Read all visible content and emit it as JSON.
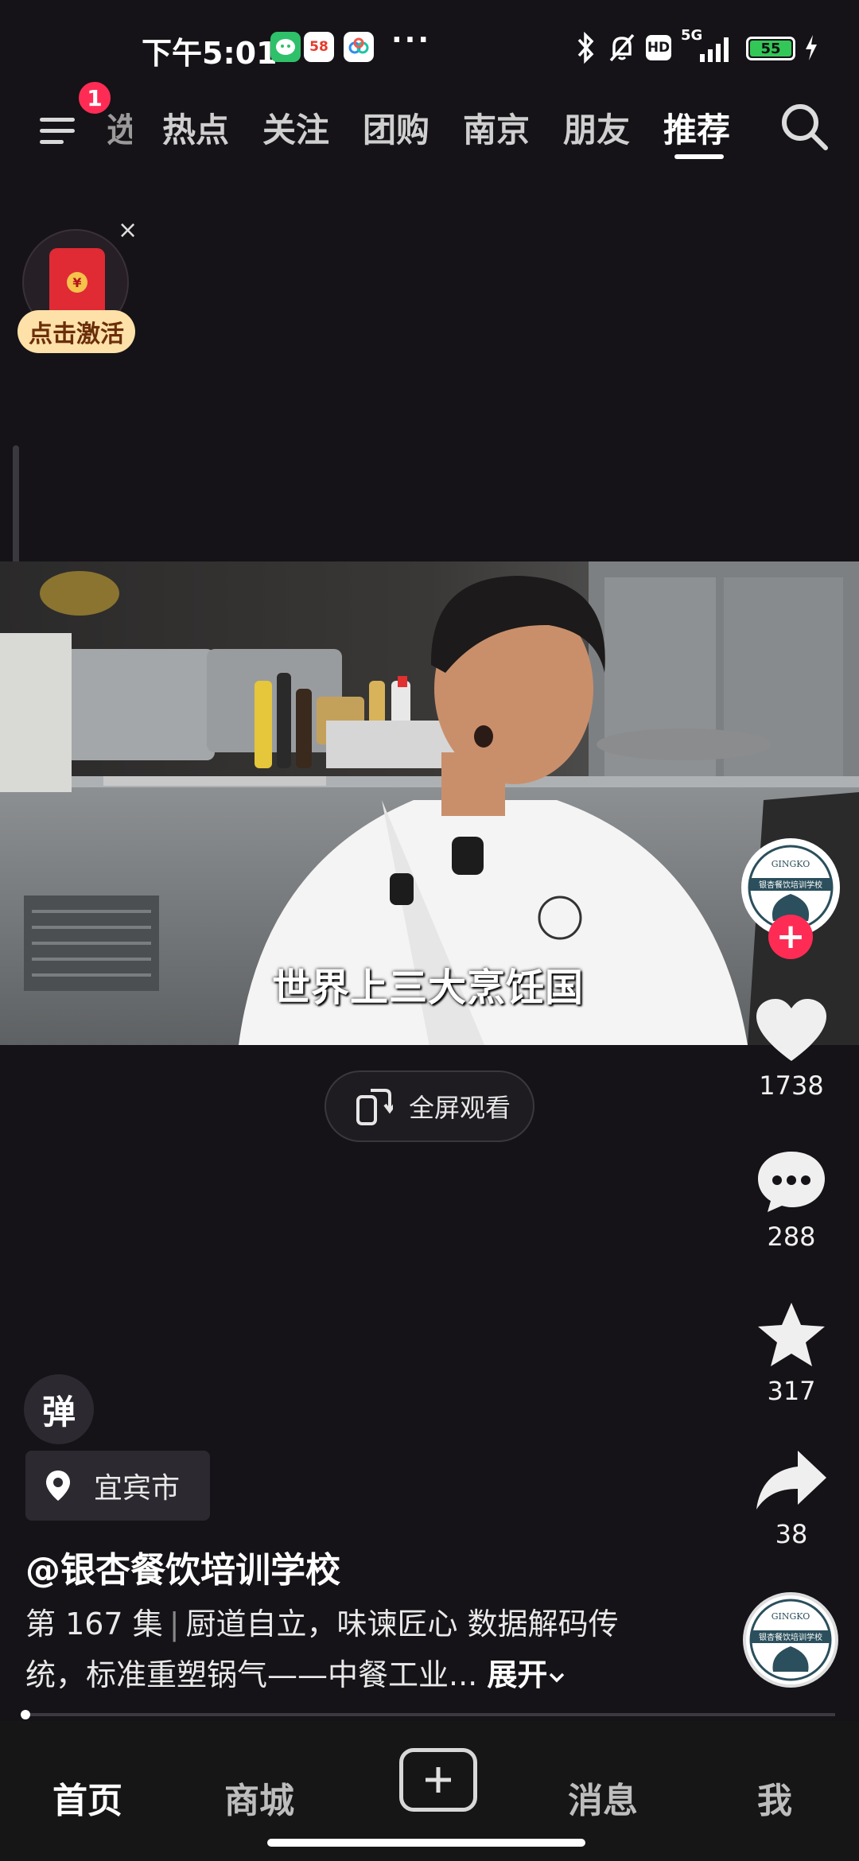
{
  "status_bar": {
    "time": "下午5:01",
    "app_icons": [
      "wechat-icon",
      "58-app-icon",
      "cloud-app-icon"
    ],
    "more": "···",
    "network": "5G",
    "hd": "HD",
    "battery": "55"
  },
  "top_nav": {
    "menu_badge": "1",
    "partial_tab": "选",
    "tabs": [
      "热点",
      "关注",
      "团购",
      "南京",
      "朋友",
      "推荐"
    ],
    "active_tab": "推荐"
  },
  "promo": {
    "activate_label": "点击激活",
    "close": "×",
    "coin": "¥"
  },
  "video": {
    "subtitle": "世界上三大烹饪国",
    "fullscreen_label": "全屏观看"
  },
  "side_actions": {
    "likes": "1738",
    "comments": "288",
    "favorites": "317",
    "shares": "38",
    "follow_plus": "+"
  },
  "post": {
    "danmu_label": "弹",
    "location": "宜宾市",
    "author": "@银杏餐饮培训学校",
    "episode": "第 167 集",
    "desc_line1": "厨道自立，味谏匠心 数据解码传",
    "desc_line2": "统，标准重塑锅气——中餐工业...",
    "expand_label": "展开"
  },
  "bottom_nav": {
    "items": [
      "首页",
      "商城",
      "消息",
      "我"
    ]
  },
  "colors": {
    "background": "#151317",
    "accent": "#fe2c55",
    "activate_bg": "#fde1a8"
  }
}
